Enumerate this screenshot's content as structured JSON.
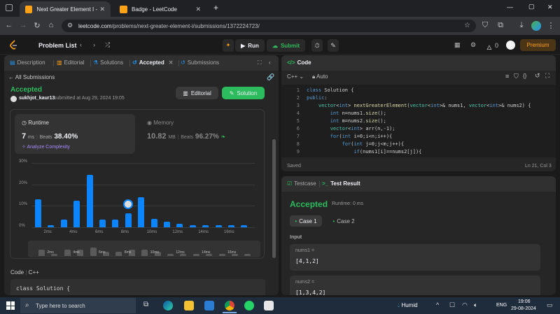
{
  "browser": {
    "tabs": [
      {
        "title": "Next Greater Element I - LeetC",
        "active": true
      },
      {
        "title": "Badge - LeetCode",
        "active": false
      }
    ],
    "new_tab": "+",
    "url_domain": "leetcode.com",
    "url_path": "/problems/next-greater-element-i/submissions/1372224723/",
    "window_controls": [
      "—",
      "▢",
      "✕"
    ]
  },
  "lc_header": {
    "problem_list": "Problem List",
    "run": "Run",
    "submit": "Submit",
    "notifications": "0",
    "premium": "Premium"
  },
  "left_tabs": [
    "Description",
    "Editorial",
    "Solutions",
    "Accepted",
    "Submissions"
  ],
  "submission": {
    "back": "All Submissions",
    "status": "Accepted",
    "user": "sukhjot_kaur13",
    "submitted": "submitted at Aug 29, 2024 19:05",
    "editorial_btn": "Editorial",
    "solution_btn": "Solution",
    "runtime_label": "Runtime",
    "runtime_value": "7",
    "runtime_unit": "ms",
    "beats_label": "Beats",
    "runtime_beats": "38.40%",
    "analyze": "Analyze Complexity",
    "memory_label": "Memory",
    "memory_value": "10.82",
    "memory_unit": "MB",
    "memory_beats": "96.27%"
  },
  "chart_data": {
    "type": "bar",
    "y_ticks": [
      "30%",
      "20%",
      "10%",
      "0%"
    ],
    "x_ticks": [
      "2ms",
      "4ms",
      "6ms",
      "8ms",
      "10ms",
      "12ms",
      "14ms",
      "16ms"
    ],
    "ylim": [
      0,
      30
    ],
    "values": [
      13,
      1,
      3.5,
      12.5,
      24.5,
      3.5,
      3.5,
      6.5,
      14,
      4,
      2.5,
      1.5,
      1,
      1,
      1,
      1,
      1
    ],
    "highlight_index": 7,
    "mini_values": [
      3,
      1,
      3,
      3,
      4,
      2,
      2,
      3,
      3,
      2,
      1,
      1,
      1,
      1,
      1,
      1,
      1
    ]
  },
  "code_section": {
    "label": "Code",
    "lang": "C++",
    "first_line": "class Solution {"
  },
  "editor": {
    "title": "Code",
    "lang": "C++",
    "auto": "Auto",
    "saved": "Saved",
    "cursor": "Ln 21, Col 3",
    "lines": [
      "class Solution {",
      "public:",
      "    vector<int> nextGreaterElement(vector<int>& nums1, vector<int>& nums2) {",
      "        int n=nums1.size();",
      "        int m=nums2.size();",
      "        vector<int> arr(n,-1);",
      "        for(int i=0;i<n;i++){",
      "            for(int j=0;j<m;j++){",
      "                if(nums1[i]==nums2[j]){"
    ]
  },
  "testpanel": {
    "testcase_tab": "Testcase",
    "result_tab": "Test Result",
    "status": "Accepted",
    "runtime": "Runtime: 0 ms",
    "cases": [
      "Case 1",
      "Case 2"
    ],
    "input_label": "Input",
    "nums1_label": "nums1 =",
    "nums1_value": "[4,1,2]",
    "nums2_label": "nums2 =",
    "nums2_value": "[1,3,4,2]"
  },
  "taskbar": {
    "search_placeholder": "Type here to search",
    "weather": "Humid",
    "lang": "ENG",
    "time": "19:06",
    "date": "29-08-2024"
  }
}
